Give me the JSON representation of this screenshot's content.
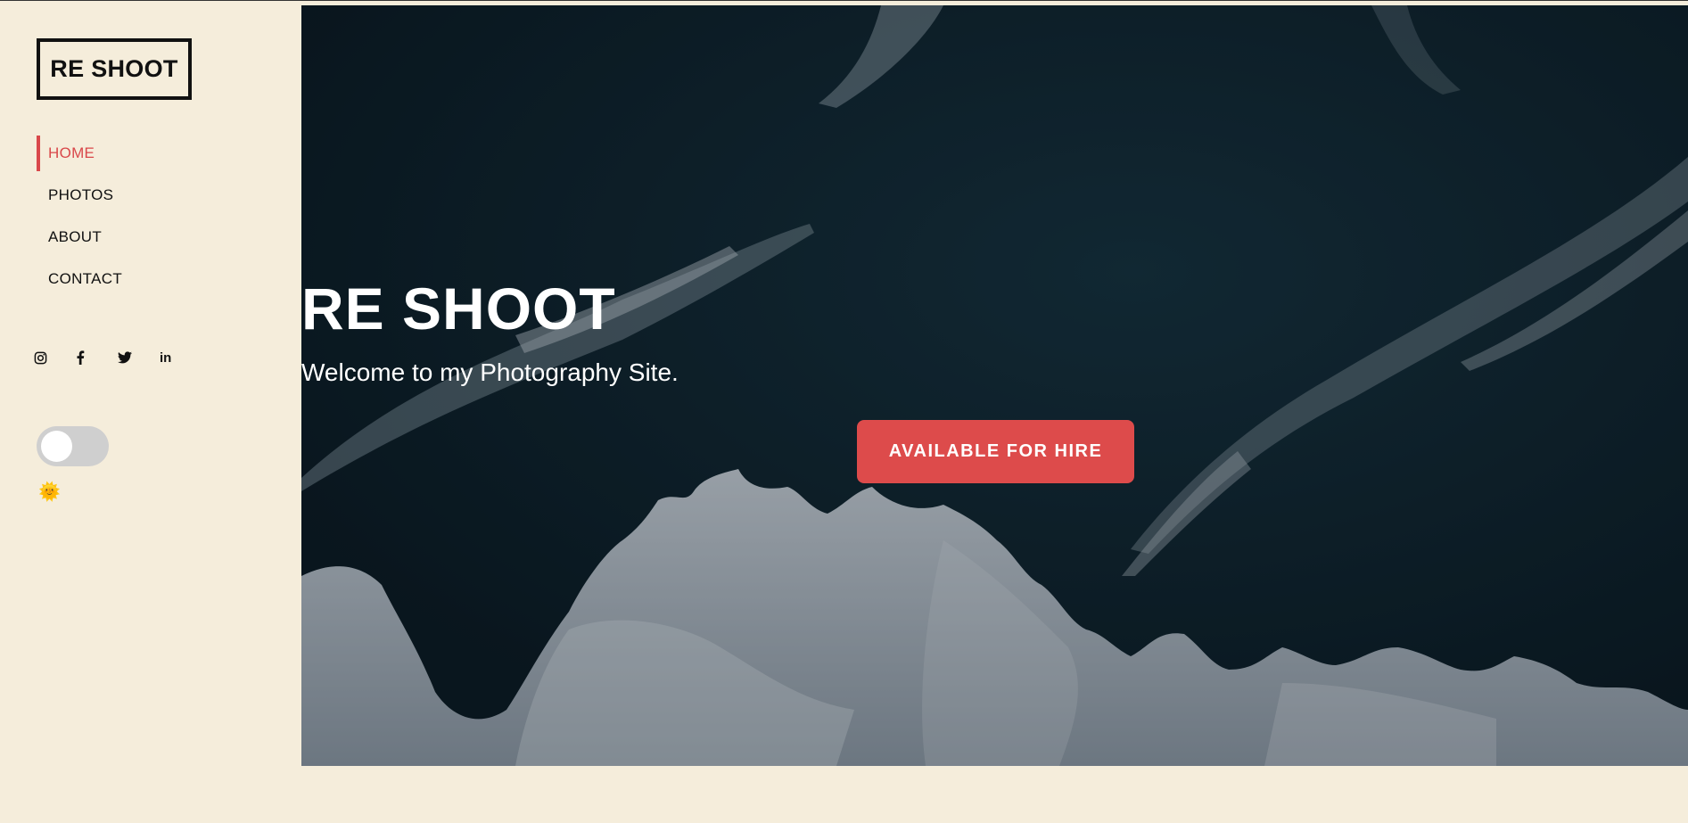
{
  "brand": {
    "logo_text": "RE SHOOT"
  },
  "nav": {
    "items": [
      {
        "label": "HOME",
        "active": true
      },
      {
        "label": "PHOTOS",
        "active": false
      },
      {
        "label": "ABOUT",
        "active": false
      },
      {
        "label": "CONTACT",
        "active": false
      }
    ]
  },
  "social": {
    "icons": [
      "instagram-icon",
      "facebook-icon",
      "twitter-icon",
      "linkedin-icon"
    ],
    "linkedin_text": "in"
  },
  "theme_toggle": {
    "state": "off",
    "icon": "sun-face-emoji",
    "glyph": "🌞"
  },
  "hero": {
    "title": "RE SHOOT",
    "subtitle": "Welcome to my Photography Site.",
    "button_label": "AVAILABLE FOR HIRE",
    "image": "aerial ocean waves and snowy shoreline"
  },
  "colors": {
    "background": "#f5eddb",
    "accent": "#dd4b4b",
    "active_nav": "#d9484a",
    "text": "#111111",
    "toggle_track": "#cfcfcf"
  }
}
